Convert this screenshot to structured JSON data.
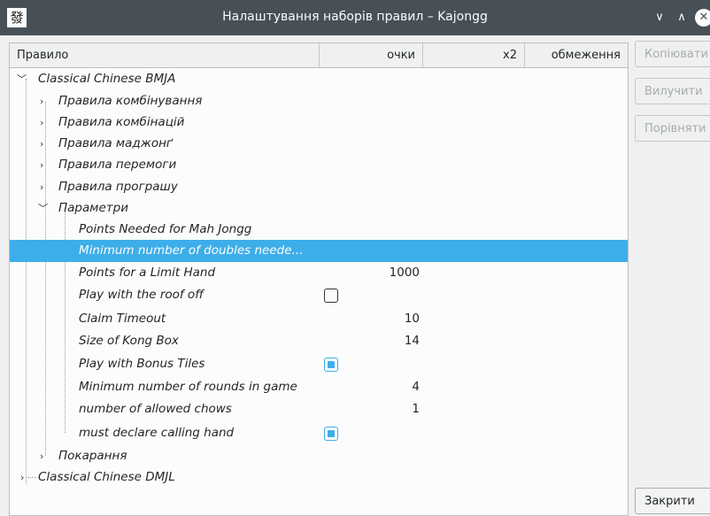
{
  "window": {
    "title": "Налаштування наборів правил – Kajongg",
    "app_icon": "發",
    "controls": {
      "minimize": "∨",
      "maximize": "∧",
      "close": "✕"
    }
  },
  "tree": {
    "columns": [
      "Правило",
      "очки",
      "x2",
      "обмеження"
    ],
    "rows": [
      {
        "label": "Classical Chinese BMJA",
        "expanded": true
      },
      {
        "label": "Правила комбінування",
        "expanded": false
      },
      {
        "label": "Правила комбінацій",
        "expanded": false
      },
      {
        "label": "Правила маджонґ",
        "expanded": false
      },
      {
        "label": "Правила перемоги",
        "expanded": false
      },
      {
        "label": "Правила програшу",
        "expanded": false
      },
      {
        "label": "Параметри",
        "expanded": true
      },
      {
        "label": "Points Needed for Mah Jongg",
        "value": ""
      },
      {
        "label": "Minimum number of doubles neede...",
        "value": "",
        "selected": true
      },
      {
        "label": "Points for a Limit Hand",
        "value": "1000"
      },
      {
        "label": "Play with the roof off",
        "checked": false
      },
      {
        "label": "Claim Timeout",
        "value": "10"
      },
      {
        "label": "Size of Kong Box",
        "value": "14"
      },
      {
        "label": "Play with Bonus Tiles",
        "checked": true
      },
      {
        "label": "Minimum number of rounds in game",
        "value": "4"
      },
      {
        "label": "number of allowed chows",
        "value": "1"
      },
      {
        "label": "must declare calling hand",
        "checked": true
      },
      {
        "label": "Покарання",
        "expanded": false
      },
      {
        "label": "Classical Chinese DMJL",
        "expanded": false
      }
    ]
  },
  "buttons": {
    "copy": "Копіювати",
    "remove": "Вилучити",
    "compare": "Порівняти",
    "close": "Закрити"
  },
  "colors": {
    "titlebar": "#475057",
    "selection": "#3daee9",
    "background": "#eff0f1"
  }
}
